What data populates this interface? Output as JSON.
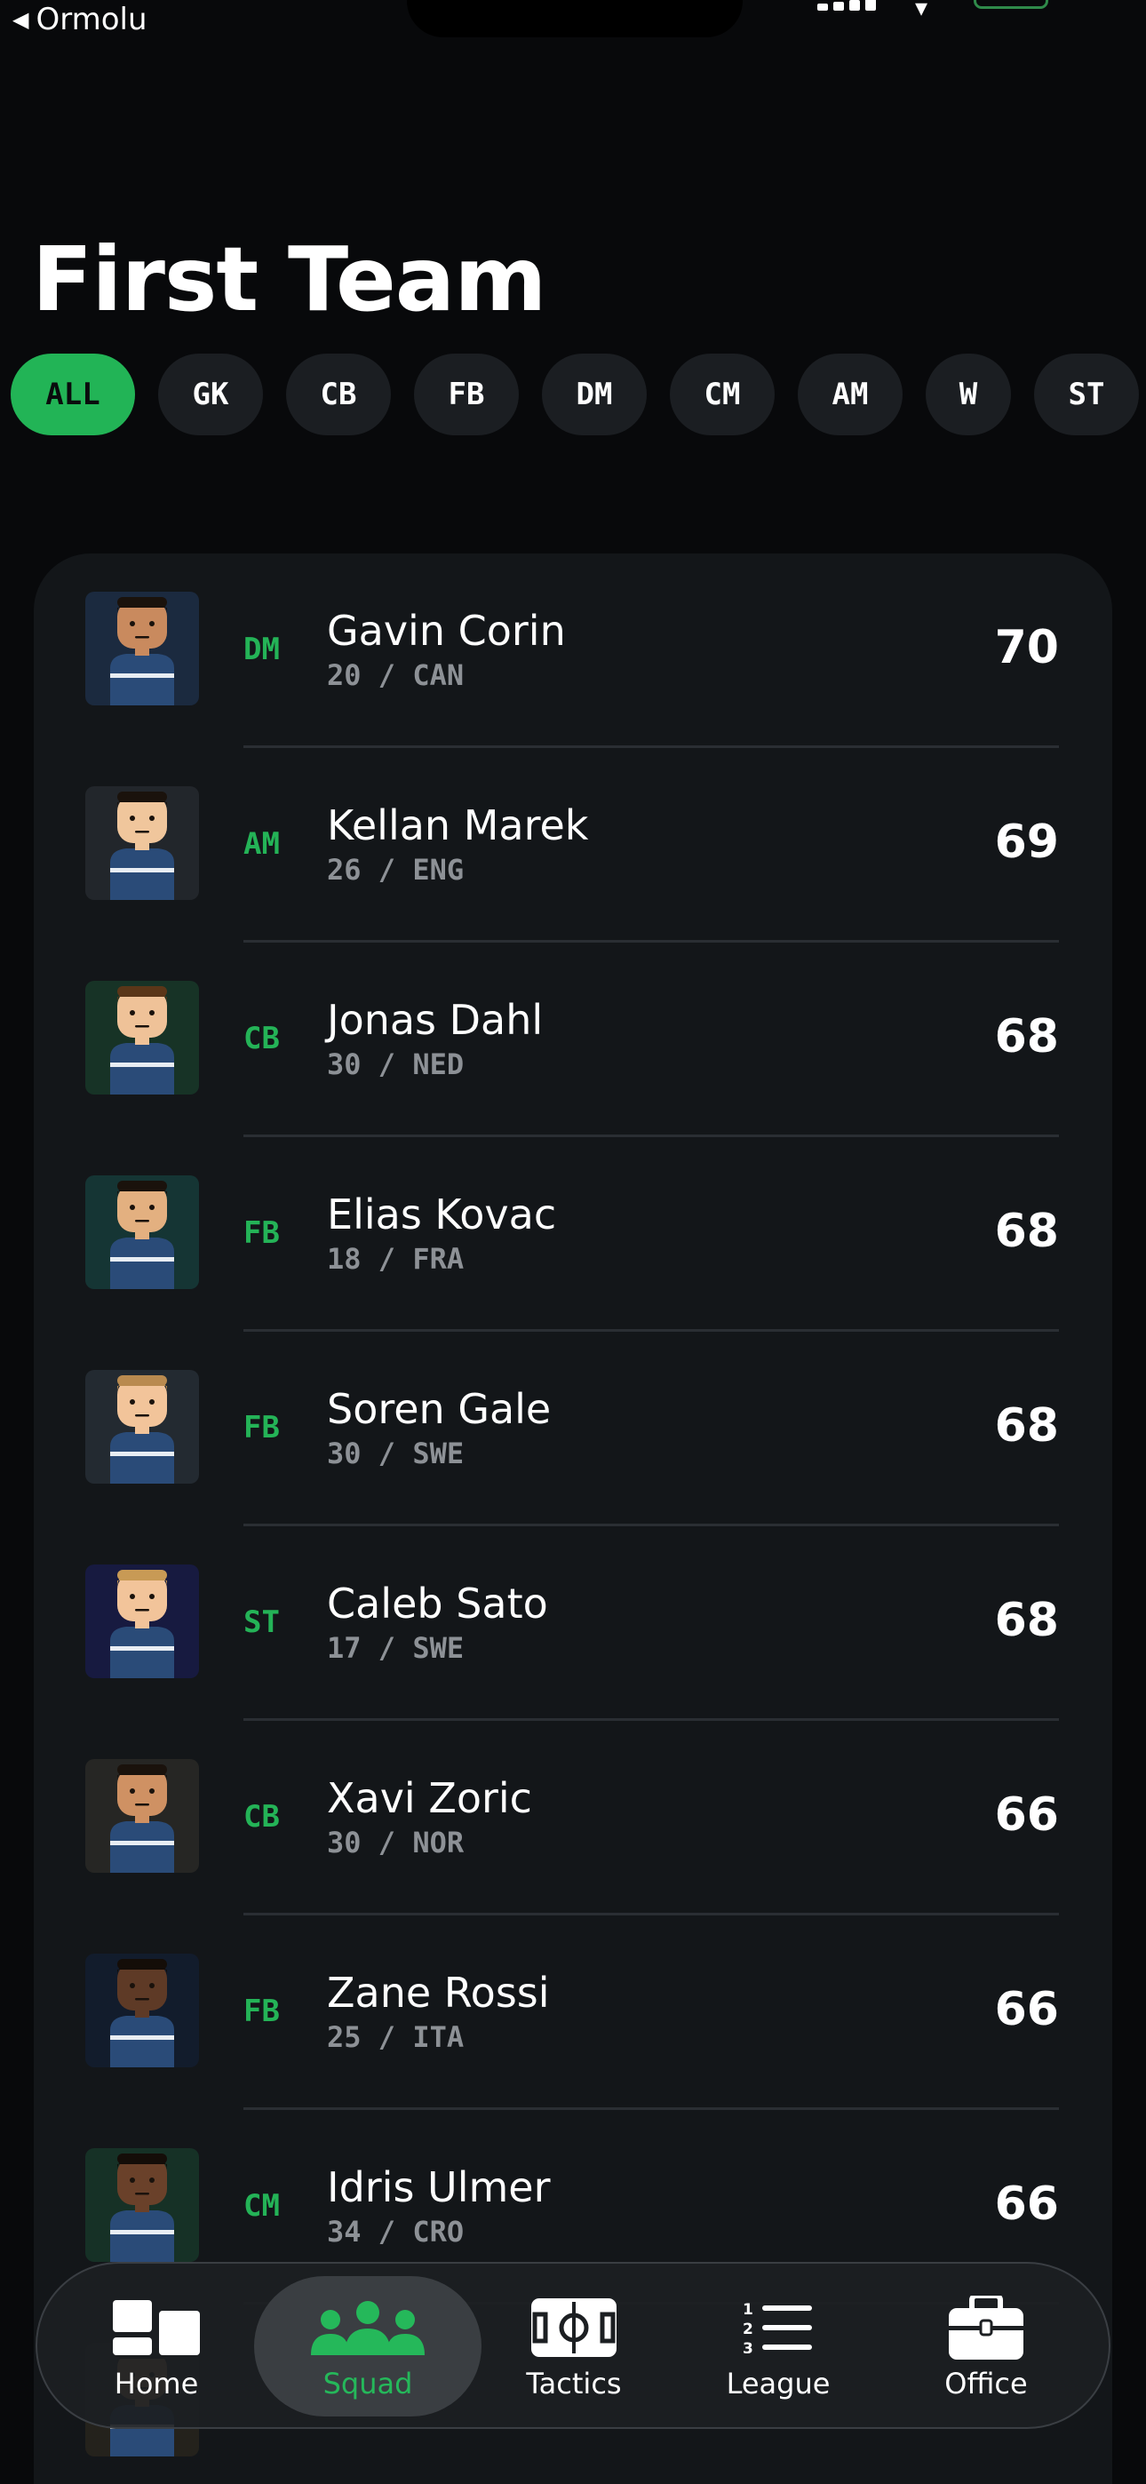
{
  "status_bar": {
    "back_app": "Ormolu"
  },
  "page_title": "First Team",
  "filters": [
    {
      "label": "ALL",
      "active": true
    },
    {
      "label": "GK",
      "active": false
    },
    {
      "label": "CB",
      "active": false
    },
    {
      "label": "FB",
      "active": false
    },
    {
      "label": "DM",
      "active": false
    },
    {
      "label": "CM",
      "active": false
    },
    {
      "label": "AM",
      "active": false
    },
    {
      "label": "W",
      "active": false
    },
    {
      "label": "ST",
      "active": false
    }
  ],
  "players": [
    {
      "pos": "DM",
      "name": "Gavin Corin",
      "meta": "20 / CAN",
      "rating": "70",
      "bg": "#1b2a3f",
      "skin": "#c98a5e",
      "hair": "#1a120c"
    },
    {
      "pos": "AM",
      "name": "Kellan Marek",
      "meta": "26 / ENG",
      "rating": "69",
      "bg": "#22262b",
      "skin": "#f0c69c",
      "hair": "#1a120c"
    },
    {
      "pos": "CB",
      "name": "Jonas Dahl",
      "meta": "30 / NED",
      "rating": "68",
      "bg": "#173326",
      "skin": "#efc298",
      "hair": "#5a3618"
    },
    {
      "pos": "FB",
      "name": "Elias Kovac",
      "meta": "18 / FRA",
      "rating": "68",
      "bg": "#153534",
      "skin": "#e3b080",
      "hair": "#1a120c"
    },
    {
      "pos": "FB",
      "name": "Soren Gale",
      "meta": "30 / SWE",
      "rating": "68",
      "bg": "#232a31",
      "skin": "#f2c49a",
      "hair": "#b98a4f"
    },
    {
      "pos": "ST",
      "name": "Caleb Sato",
      "meta": "17 / SWE",
      "rating": "68",
      "bg": "#171a40",
      "skin": "#f2c49a",
      "hair": "#c89a55"
    },
    {
      "pos": "CB",
      "name": "Xavi Zoric",
      "meta": "30 / NOR",
      "rating": "66",
      "bg": "#262624",
      "skin": "#cf9163",
      "hair": "#1a120c"
    },
    {
      "pos": "FB",
      "name": "Zane Rossi",
      "meta": "25 / ITA",
      "rating": "66",
      "bg": "#121c2c",
      "skin": "#5e3a26",
      "hair": "#140d08"
    },
    {
      "pos": "CM",
      "name": "Idris Ulmer",
      "meta": "34 / CRO",
      "rating": "66",
      "bg": "#163126",
      "skin": "#6a412a",
      "hair": "#140d08"
    },
    {
      "pos": "",
      "name": "",
      "meta": "",
      "rating": "",
      "bg": "#24221c",
      "skin": "#c98a5e",
      "hair": "#1a120c"
    }
  ],
  "tabs": [
    {
      "label": "Home",
      "icon": "home-grid-icon",
      "active": false
    },
    {
      "label": "Squad",
      "icon": "squad-people-icon",
      "active": true
    },
    {
      "label": "Tactics",
      "icon": "tactics-pitch-icon",
      "active": false
    },
    {
      "label": "League",
      "icon": "league-list-icon",
      "active": false
    },
    {
      "label": "Office",
      "icon": "office-briefcase-icon",
      "active": false
    }
  ],
  "colors": {
    "accent": "#22b456",
    "background": "#08090b",
    "card": "#131619",
    "muted": "#8d9196"
  }
}
